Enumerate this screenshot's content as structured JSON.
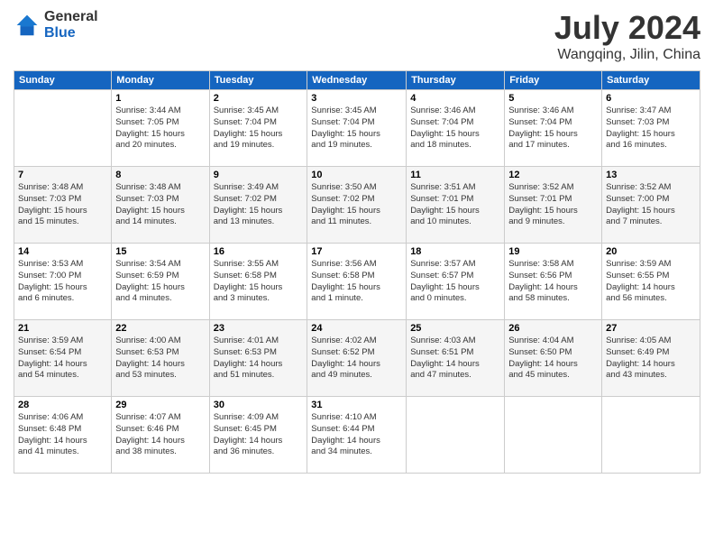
{
  "logo": {
    "general": "General",
    "blue": "Blue"
  },
  "header": {
    "month": "July 2024",
    "location": "Wangqing, Jilin, China"
  },
  "weekdays": [
    "Sunday",
    "Monday",
    "Tuesday",
    "Wednesday",
    "Thursday",
    "Friday",
    "Saturday"
  ],
  "weeks": [
    [
      {
        "day": "",
        "info": ""
      },
      {
        "day": "1",
        "info": "Sunrise: 3:44 AM\nSunset: 7:05 PM\nDaylight: 15 hours\nand 20 minutes."
      },
      {
        "day": "2",
        "info": "Sunrise: 3:45 AM\nSunset: 7:04 PM\nDaylight: 15 hours\nand 19 minutes."
      },
      {
        "day": "3",
        "info": "Sunrise: 3:45 AM\nSunset: 7:04 PM\nDaylight: 15 hours\nand 19 minutes."
      },
      {
        "day": "4",
        "info": "Sunrise: 3:46 AM\nSunset: 7:04 PM\nDaylight: 15 hours\nand 18 minutes."
      },
      {
        "day": "5",
        "info": "Sunrise: 3:46 AM\nSunset: 7:04 PM\nDaylight: 15 hours\nand 17 minutes."
      },
      {
        "day": "6",
        "info": "Sunrise: 3:47 AM\nSunset: 7:03 PM\nDaylight: 15 hours\nand 16 minutes."
      }
    ],
    [
      {
        "day": "7",
        "info": "Sunrise: 3:48 AM\nSunset: 7:03 PM\nDaylight: 15 hours\nand 15 minutes."
      },
      {
        "day": "8",
        "info": "Sunrise: 3:48 AM\nSunset: 7:03 PM\nDaylight: 15 hours\nand 14 minutes."
      },
      {
        "day": "9",
        "info": "Sunrise: 3:49 AM\nSunset: 7:02 PM\nDaylight: 15 hours\nand 13 minutes."
      },
      {
        "day": "10",
        "info": "Sunrise: 3:50 AM\nSunset: 7:02 PM\nDaylight: 15 hours\nand 11 minutes."
      },
      {
        "day": "11",
        "info": "Sunrise: 3:51 AM\nSunset: 7:01 PM\nDaylight: 15 hours\nand 10 minutes."
      },
      {
        "day": "12",
        "info": "Sunrise: 3:52 AM\nSunset: 7:01 PM\nDaylight: 15 hours\nand 9 minutes."
      },
      {
        "day": "13",
        "info": "Sunrise: 3:52 AM\nSunset: 7:00 PM\nDaylight: 15 hours\nand 7 minutes."
      }
    ],
    [
      {
        "day": "14",
        "info": "Sunrise: 3:53 AM\nSunset: 7:00 PM\nDaylight: 15 hours\nand 6 minutes."
      },
      {
        "day": "15",
        "info": "Sunrise: 3:54 AM\nSunset: 6:59 PM\nDaylight: 15 hours\nand 4 minutes."
      },
      {
        "day": "16",
        "info": "Sunrise: 3:55 AM\nSunset: 6:58 PM\nDaylight: 15 hours\nand 3 minutes."
      },
      {
        "day": "17",
        "info": "Sunrise: 3:56 AM\nSunset: 6:58 PM\nDaylight: 15 hours\nand 1 minute."
      },
      {
        "day": "18",
        "info": "Sunrise: 3:57 AM\nSunset: 6:57 PM\nDaylight: 15 hours\nand 0 minutes."
      },
      {
        "day": "19",
        "info": "Sunrise: 3:58 AM\nSunset: 6:56 PM\nDaylight: 14 hours\nand 58 minutes."
      },
      {
        "day": "20",
        "info": "Sunrise: 3:59 AM\nSunset: 6:55 PM\nDaylight: 14 hours\nand 56 minutes."
      }
    ],
    [
      {
        "day": "21",
        "info": "Sunrise: 3:59 AM\nSunset: 6:54 PM\nDaylight: 14 hours\nand 54 minutes."
      },
      {
        "day": "22",
        "info": "Sunrise: 4:00 AM\nSunset: 6:53 PM\nDaylight: 14 hours\nand 53 minutes."
      },
      {
        "day": "23",
        "info": "Sunrise: 4:01 AM\nSunset: 6:53 PM\nDaylight: 14 hours\nand 51 minutes."
      },
      {
        "day": "24",
        "info": "Sunrise: 4:02 AM\nSunset: 6:52 PM\nDaylight: 14 hours\nand 49 minutes."
      },
      {
        "day": "25",
        "info": "Sunrise: 4:03 AM\nSunset: 6:51 PM\nDaylight: 14 hours\nand 47 minutes."
      },
      {
        "day": "26",
        "info": "Sunrise: 4:04 AM\nSunset: 6:50 PM\nDaylight: 14 hours\nand 45 minutes."
      },
      {
        "day": "27",
        "info": "Sunrise: 4:05 AM\nSunset: 6:49 PM\nDaylight: 14 hours\nand 43 minutes."
      }
    ],
    [
      {
        "day": "28",
        "info": "Sunrise: 4:06 AM\nSunset: 6:48 PM\nDaylight: 14 hours\nand 41 minutes."
      },
      {
        "day": "29",
        "info": "Sunrise: 4:07 AM\nSunset: 6:46 PM\nDaylight: 14 hours\nand 38 minutes."
      },
      {
        "day": "30",
        "info": "Sunrise: 4:09 AM\nSunset: 6:45 PM\nDaylight: 14 hours\nand 36 minutes."
      },
      {
        "day": "31",
        "info": "Sunrise: 4:10 AM\nSunset: 6:44 PM\nDaylight: 14 hours\nand 34 minutes."
      },
      {
        "day": "",
        "info": ""
      },
      {
        "day": "",
        "info": ""
      },
      {
        "day": "",
        "info": ""
      }
    ]
  ]
}
